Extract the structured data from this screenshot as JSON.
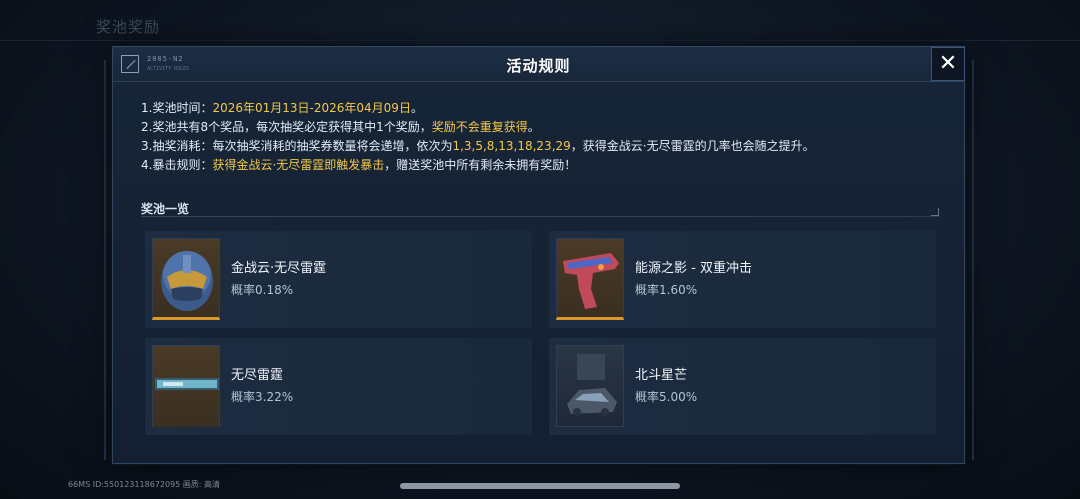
{
  "background": {
    "title": "奖池奖励"
  },
  "modal": {
    "title": "活动规则",
    "header_code": "2005-N2",
    "header_sub": "ACTIVITY RULES",
    "close_icon": "close-icon"
  },
  "rules": {
    "line1_prefix": "1.奖池时间：",
    "line1_date": "2026年01月13日-2026年04月09日",
    "line1_suffix": "。",
    "line2_prefix": "2.奖池共有8个奖品，每次抽奖必定获得其中1个奖励，",
    "line2_highlight": "奖励不会重复获得",
    "line2_suffix": "。",
    "line3_prefix": "3.抽奖消耗：每次抽奖消耗的抽奖券数量将会递增，依次为",
    "line3_highlight": "1,3,5,8,13,18,23,29",
    "line3_suffix": "，获得金战云·无尽雷霆的几率也会随之提升。",
    "line4_prefix": "4.暴击规则：",
    "line4_highlight": "获得金战云·无尽雷霆即触发暴击",
    "line4_suffix": "，赠送奖池中所有剩余未拥有奖励！"
  },
  "pool": {
    "section_title": "奖池一览",
    "items": [
      {
        "name": "金战云·无尽雷霆",
        "prob": "概率0.18%",
        "icon": "helmet-icon"
      },
      {
        "name": "能源之影 - 双重冲击",
        "prob": "概率1.60%",
        "icon": "pistol-icon"
      },
      {
        "name": "无尽雷霆",
        "prob": "概率3.22%",
        "icon": "rifle-icon"
      },
      {
        "name": "北斗星芒",
        "prob": "概率5.00%",
        "icon": "vehicle-icon"
      }
    ]
  },
  "footer": {
    "info": "66MS  ID:550123118672095   画质: 高清"
  },
  "colors": {
    "accent_gold": "#f4c84a",
    "panel": "#172538",
    "border": "#2f4763"
  }
}
